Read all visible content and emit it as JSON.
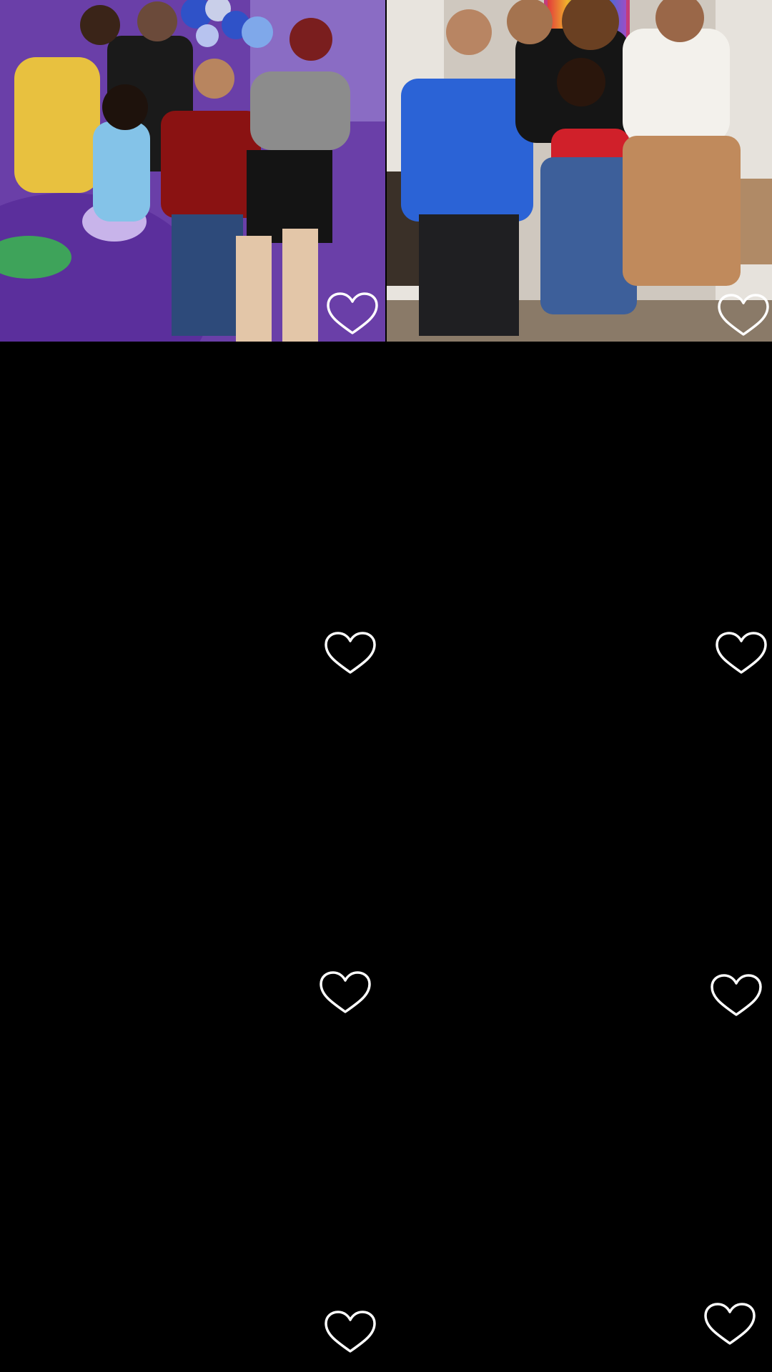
{
  "feed": {
    "tiles": [
      {
        "kind": "photo",
        "scene": "party-family-purple-backdrop",
        "like_icon": "heart-outline-icon"
      },
      {
        "kind": "photo",
        "scene": "party-family-living-room",
        "like_icon": "heart-outline-icon"
      },
      {
        "kind": "blank",
        "like_icon": "heart-outline-icon"
      },
      {
        "kind": "blank",
        "like_icon": "heart-outline-icon"
      },
      {
        "kind": "blank",
        "like_icon": "heart-outline-icon"
      },
      {
        "kind": "blank",
        "like_icon": "heart-outline-icon"
      },
      {
        "kind": "blank",
        "like_icon": "heart-outline-icon"
      },
      {
        "kind": "blank",
        "like_icon": "heart-outline-icon"
      }
    ]
  },
  "colors": {
    "background": "#000000",
    "icon": "#ffffff",
    "backdrop_purple": "#6a3fa8",
    "tablecloth_purple": "#5b2f9c",
    "balloon_blue": "#2f52c8"
  }
}
